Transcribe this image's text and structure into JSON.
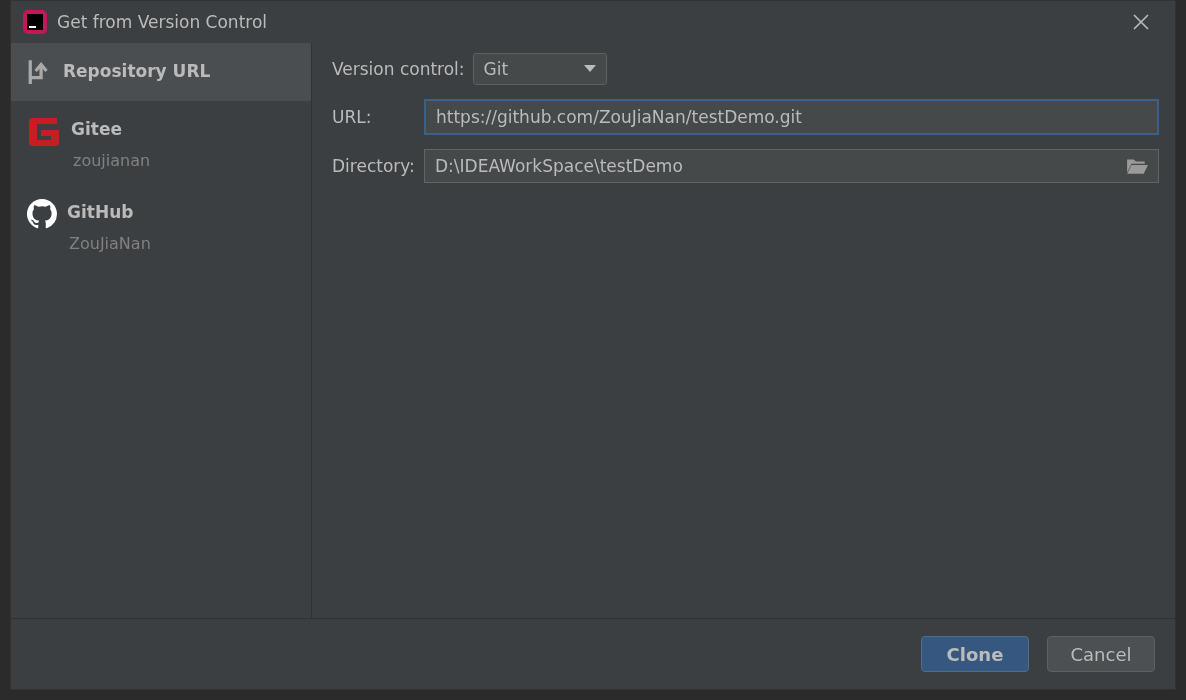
{
  "window": {
    "title": "Get from Version Control"
  },
  "sidebar": {
    "items": [
      {
        "kind": "url",
        "label": "Repository URL",
        "selected": true
      },
      {
        "kind": "gitee",
        "label": "Gitee",
        "account": "zoujianan",
        "selected": false
      },
      {
        "kind": "github",
        "label": "GitHub",
        "account": "ZouJiaNan",
        "selected": false
      }
    ]
  },
  "form": {
    "version_control": {
      "label": "Version control:",
      "value": "Git"
    },
    "url": {
      "label": "URL:",
      "value": "https://github.com/ZouJiaNan/testDemo.git",
      "focused": true
    },
    "directory": {
      "label": "Directory:",
      "value": "D:\\IDEAWorkSpace\\testDemo"
    }
  },
  "buttons": [
    {
      "label": "Clone",
      "kind": "primary"
    },
    {
      "label": "Cancel",
      "kind": "secondary"
    }
  ]
}
